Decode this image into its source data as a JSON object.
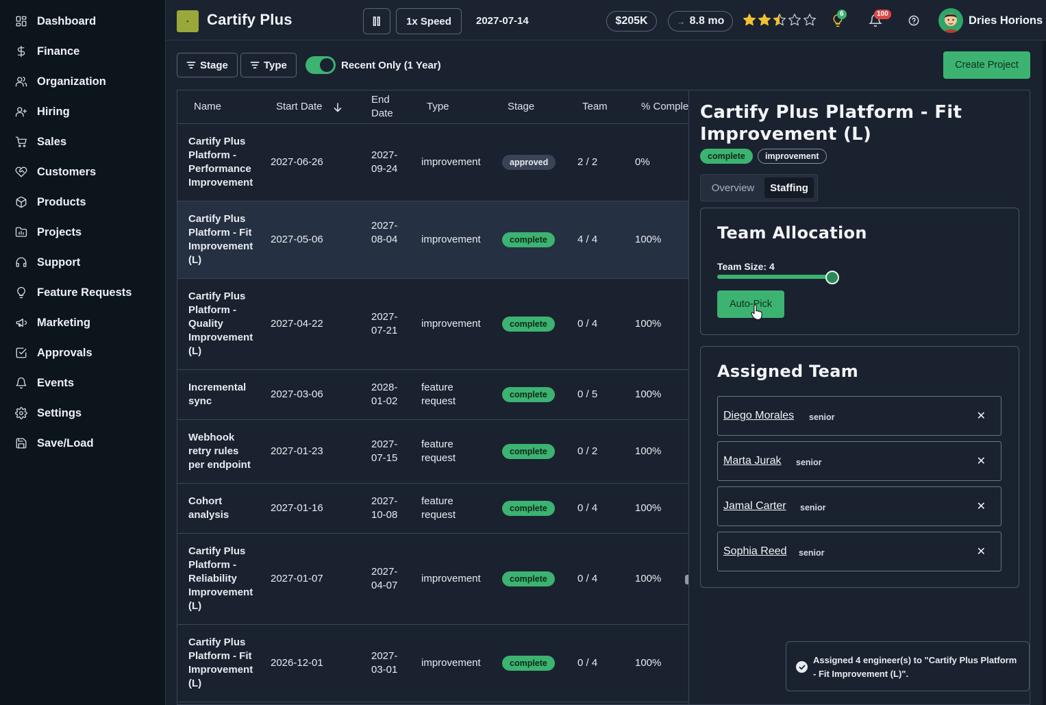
{
  "sidebar": {
    "items": [
      {
        "label": "Dashboard",
        "icon": "dashboard-icon"
      },
      {
        "label": "Finance",
        "icon": "dollar-icon"
      },
      {
        "label": "Organization",
        "icon": "users-icon"
      },
      {
        "label": "Hiring",
        "icon": "user-plus-icon"
      },
      {
        "label": "Sales",
        "icon": "cart-icon"
      },
      {
        "label": "Customers",
        "icon": "heart-handshake-icon"
      },
      {
        "label": "Products",
        "icon": "box-icon"
      },
      {
        "label": "Projects",
        "icon": "folder-chart-icon"
      },
      {
        "label": "Support",
        "icon": "headset-icon"
      },
      {
        "label": "Feature Requests",
        "icon": "lightbulb-icon"
      },
      {
        "label": "Marketing",
        "icon": "megaphone-icon"
      },
      {
        "label": "Approvals",
        "icon": "check-square-icon"
      },
      {
        "label": "Events",
        "icon": "bell-icon"
      },
      {
        "label": "Settings",
        "icon": "gear-icon"
      },
      {
        "label": "Save/Load",
        "icon": "save-icon"
      }
    ]
  },
  "header": {
    "app_title": "Cartify Plus",
    "pause_icon": "pause-icon",
    "speed_label": "1x Speed",
    "date": "2027-07-14",
    "cash": "$205K",
    "runway": "8.8 mo",
    "rating": 2.5,
    "rating_max": 5,
    "ideas_count": "6",
    "notifications_count": "100",
    "user_name": "Dries Horions"
  },
  "toolbar": {
    "stage_filter": "Stage",
    "type_filter": "Type",
    "recent_toggle_label": "Recent Only (1 Year)",
    "recent_toggle_on": true,
    "create_button": "Create Project"
  },
  "table": {
    "headers": {
      "name": "Name",
      "start_date": "Start Date",
      "end_date": "End Date",
      "type": "Type",
      "stage": "Stage",
      "team": "Team",
      "pct": "% Comple"
    },
    "rows": [
      {
        "name": "Cartify Plus Platform - Performance Improvement",
        "start": "2027-06-26",
        "end": "2027-09-24",
        "type": "improvement",
        "stage": "approved",
        "team": "2 / 2",
        "pct": "0%"
      },
      {
        "name": "Cartify Plus Platform - Fit Improvement (L)",
        "start": "2027-05-06",
        "end": "2027-08-04",
        "type": "improvement",
        "stage": "complete",
        "team": "4 / 4",
        "pct": "100%"
      },
      {
        "name": "Cartify Plus Platform - Quality Improvement (L)",
        "start": "2027-04-22",
        "end": "2027-07-21",
        "type": "improvement",
        "stage": "complete",
        "team": "0 / 4",
        "pct": "100%"
      },
      {
        "name": "Incremental sync",
        "start": "2027-03-06",
        "end": "2028-01-02",
        "type": "feature request",
        "stage": "complete",
        "team": "0 / 5",
        "pct": "100%"
      },
      {
        "name": "Webhook retry rules per endpoint",
        "start": "2027-01-23",
        "end": "2027-07-15",
        "type": "feature request",
        "stage": "complete",
        "team": "0 / 2",
        "pct": "100%"
      },
      {
        "name": "Cohort analysis",
        "start": "2027-01-16",
        "end": "2027-10-08",
        "type": "feature request",
        "stage": "complete",
        "team": "0 / 4",
        "pct": "100%"
      },
      {
        "name": "Cartify Plus Platform - Reliability Improvement (L)",
        "start": "2027-01-07",
        "end": "2027-04-07",
        "type": "improvement",
        "stage": "complete",
        "team": "0 / 4",
        "pct": "100%"
      },
      {
        "name": "Cartify Plus Platform - Fit Improvement (L)",
        "start": "2026-12-01",
        "end": "2027-03-01",
        "type": "improvement",
        "stage": "complete",
        "team": "0 / 4",
        "pct": "100%"
      }
    ]
  },
  "detail": {
    "title": "Cartify Plus Platform - Fit Improvement (L)",
    "stage_tag": "complete",
    "type_tag": "improvement",
    "tabs": [
      "Overview",
      "Staffing"
    ],
    "active_tab": "Staffing",
    "team_allocation": {
      "title": "Team Allocation",
      "team_size_label": "Team Size: 4",
      "team_size": 4,
      "autopick_label": "Auto-Pick"
    },
    "assigned_team": {
      "title": "Assigned Team",
      "members": [
        {
          "name": "Diego Morales",
          "level": "senior"
        },
        {
          "name": "Marta Jurak",
          "level": "senior"
        },
        {
          "name": "Jamal Carter",
          "level": "senior"
        },
        {
          "name": "Sophia Reed",
          "level": "senior"
        }
      ],
      "remove_symbol": "✕"
    }
  },
  "toast": {
    "message": "Assigned 4 engineer(s) to \"Cartify Plus Platform - Fit Improvement (L)\"."
  },
  "colors": {
    "accent": "#3cb371",
    "background": "#1a2230",
    "sidebar": "#0c141c"
  }
}
